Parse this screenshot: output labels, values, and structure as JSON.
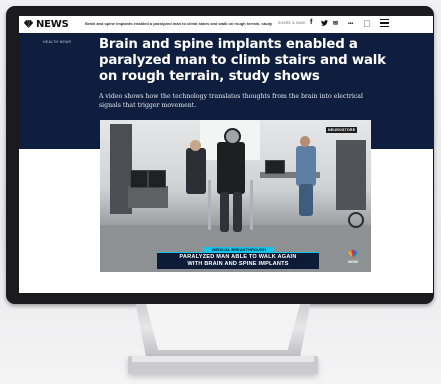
{
  "site": {
    "logo_text": "NEWS",
    "logo_icon": "nbc-peacock-icon"
  },
  "nav": {
    "headline": "Brain and spine implants enabled a paralyzed man to climb stairs and walk on rough terrain, study sho",
    "share_label": "SHARE & SAVE",
    "icons": [
      "facebook-icon",
      "twitter-icon",
      "email-icon",
      "more-icon",
      "bookmark-icon",
      "menu-icon"
    ],
    "facebook": "f",
    "twitter": "🐦",
    "email": "✉",
    "more": "•••"
  },
  "article": {
    "tag": "HEALTH NEWS",
    "headline": "Brain and spine implants enabled a paralyzed man to climb stairs and walk on rough terrain, study shows",
    "dek": "A video shows how the technology translates thoughts from the brain into electrical signals that trigger movement."
  },
  "video": {
    "badge": "NEUROSTORE",
    "lower_third_tag": "MEDICAL BREAKTHROUGH",
    "lower_third_line1": "PARALYZED MAN ABLE TO WALK AGAIN",
    "lower_third_line2": "WITH BRAIN AND SPINE IMPLANTS",
    "network_bug": "NOW"
  },
  "colors": {
    "hero_bg": "#0f1e3e",
    "accent": "#18c3e8"
  }
}
